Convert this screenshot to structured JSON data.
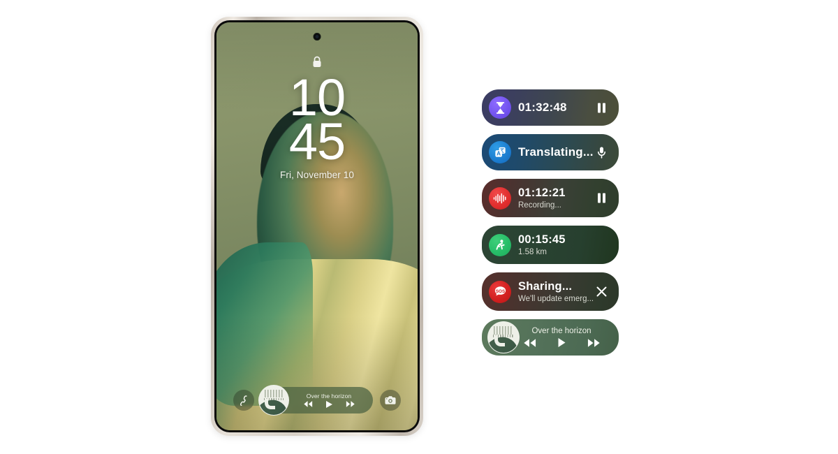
{
  "phone": {
    "status": {
      "lock_icon": "lock-icon",
      "camera_punchhole": "front-camera-icon"
    },
    "lockscreen": {
      "hours": "10",
      "minutes": "45",
      "date": "Fri, November 10"
    },
    "shortcuts": {
      "left": {
        "name": "phone-dialer-icon",
        "label": "Phone"
      },
      "right": {
        "name": "camera-icon",
        "label": "Camera"
      }
    },
    "mini_player": {
      "track_title": "Over the horizon",
      "album_art_text": "OVER THE HORIZON",
      "prev_label": "Previous",
      "play_label": "Play",
      "next_label": "Next"
    }
  },
  "live_notifications": [
    {
      "id": "timer",
      "icon": "hourglass-icon",
      "icon_color": "#7455f0",
      "title": "01:32:48",
      "subtitle": "",
      "action": "pause-button",
      "action_label": "Pause"
    },
    {
      "id": "translate",
      "icon": "translate-icon",
      "icon_color": "#1d7fd1",
      "title": "Translating...",
      "subtitle": "",
      "action": "microphone-button",
      "action_label": "Microphone"
    },
    {
      "id": "recorder",
      "icon": "voice-waveform-icon",
      "icon_color": "#e22f2f",
      "title": "01:12:21",
      "subtitle": "Recording...",
      "action": "pause-button",
      "action_label": "Pause"
    },
    {
      "id": "running",
      "icon": "running-person-icon",
      "icon_color": "#27bd68",
      "title": "00:15:45",
      "subtitle": "1.58 km",
      "action": "",
      "action_label": ""
    },
    {
      "id": "emergency-sharing",
      "icon": "sos-bubble-icon",
      "icon_color": "#d32020",
      "title": "Sharing...",
      "subtitle": "We'll update emerg...",
      "action": "close-button",
      "action_label": "Dismiss"
    },
    {
      "id": "music",
      "icon": "album-art",
      "icon_color": "#4c6a53",
      "title": "Over the horizon",
      "subtitle": "",
      "action": "media-controls",
      "action_label": "Media controls"
    }
  ],
  "music_pill": {
    "track_title": "Over the horizon",
    "album_art_text": "OVER THE HORIZON",
    "prev_label": "Previous",
    "play_label": "Play",
    "next_label": "Next"
  }
}
